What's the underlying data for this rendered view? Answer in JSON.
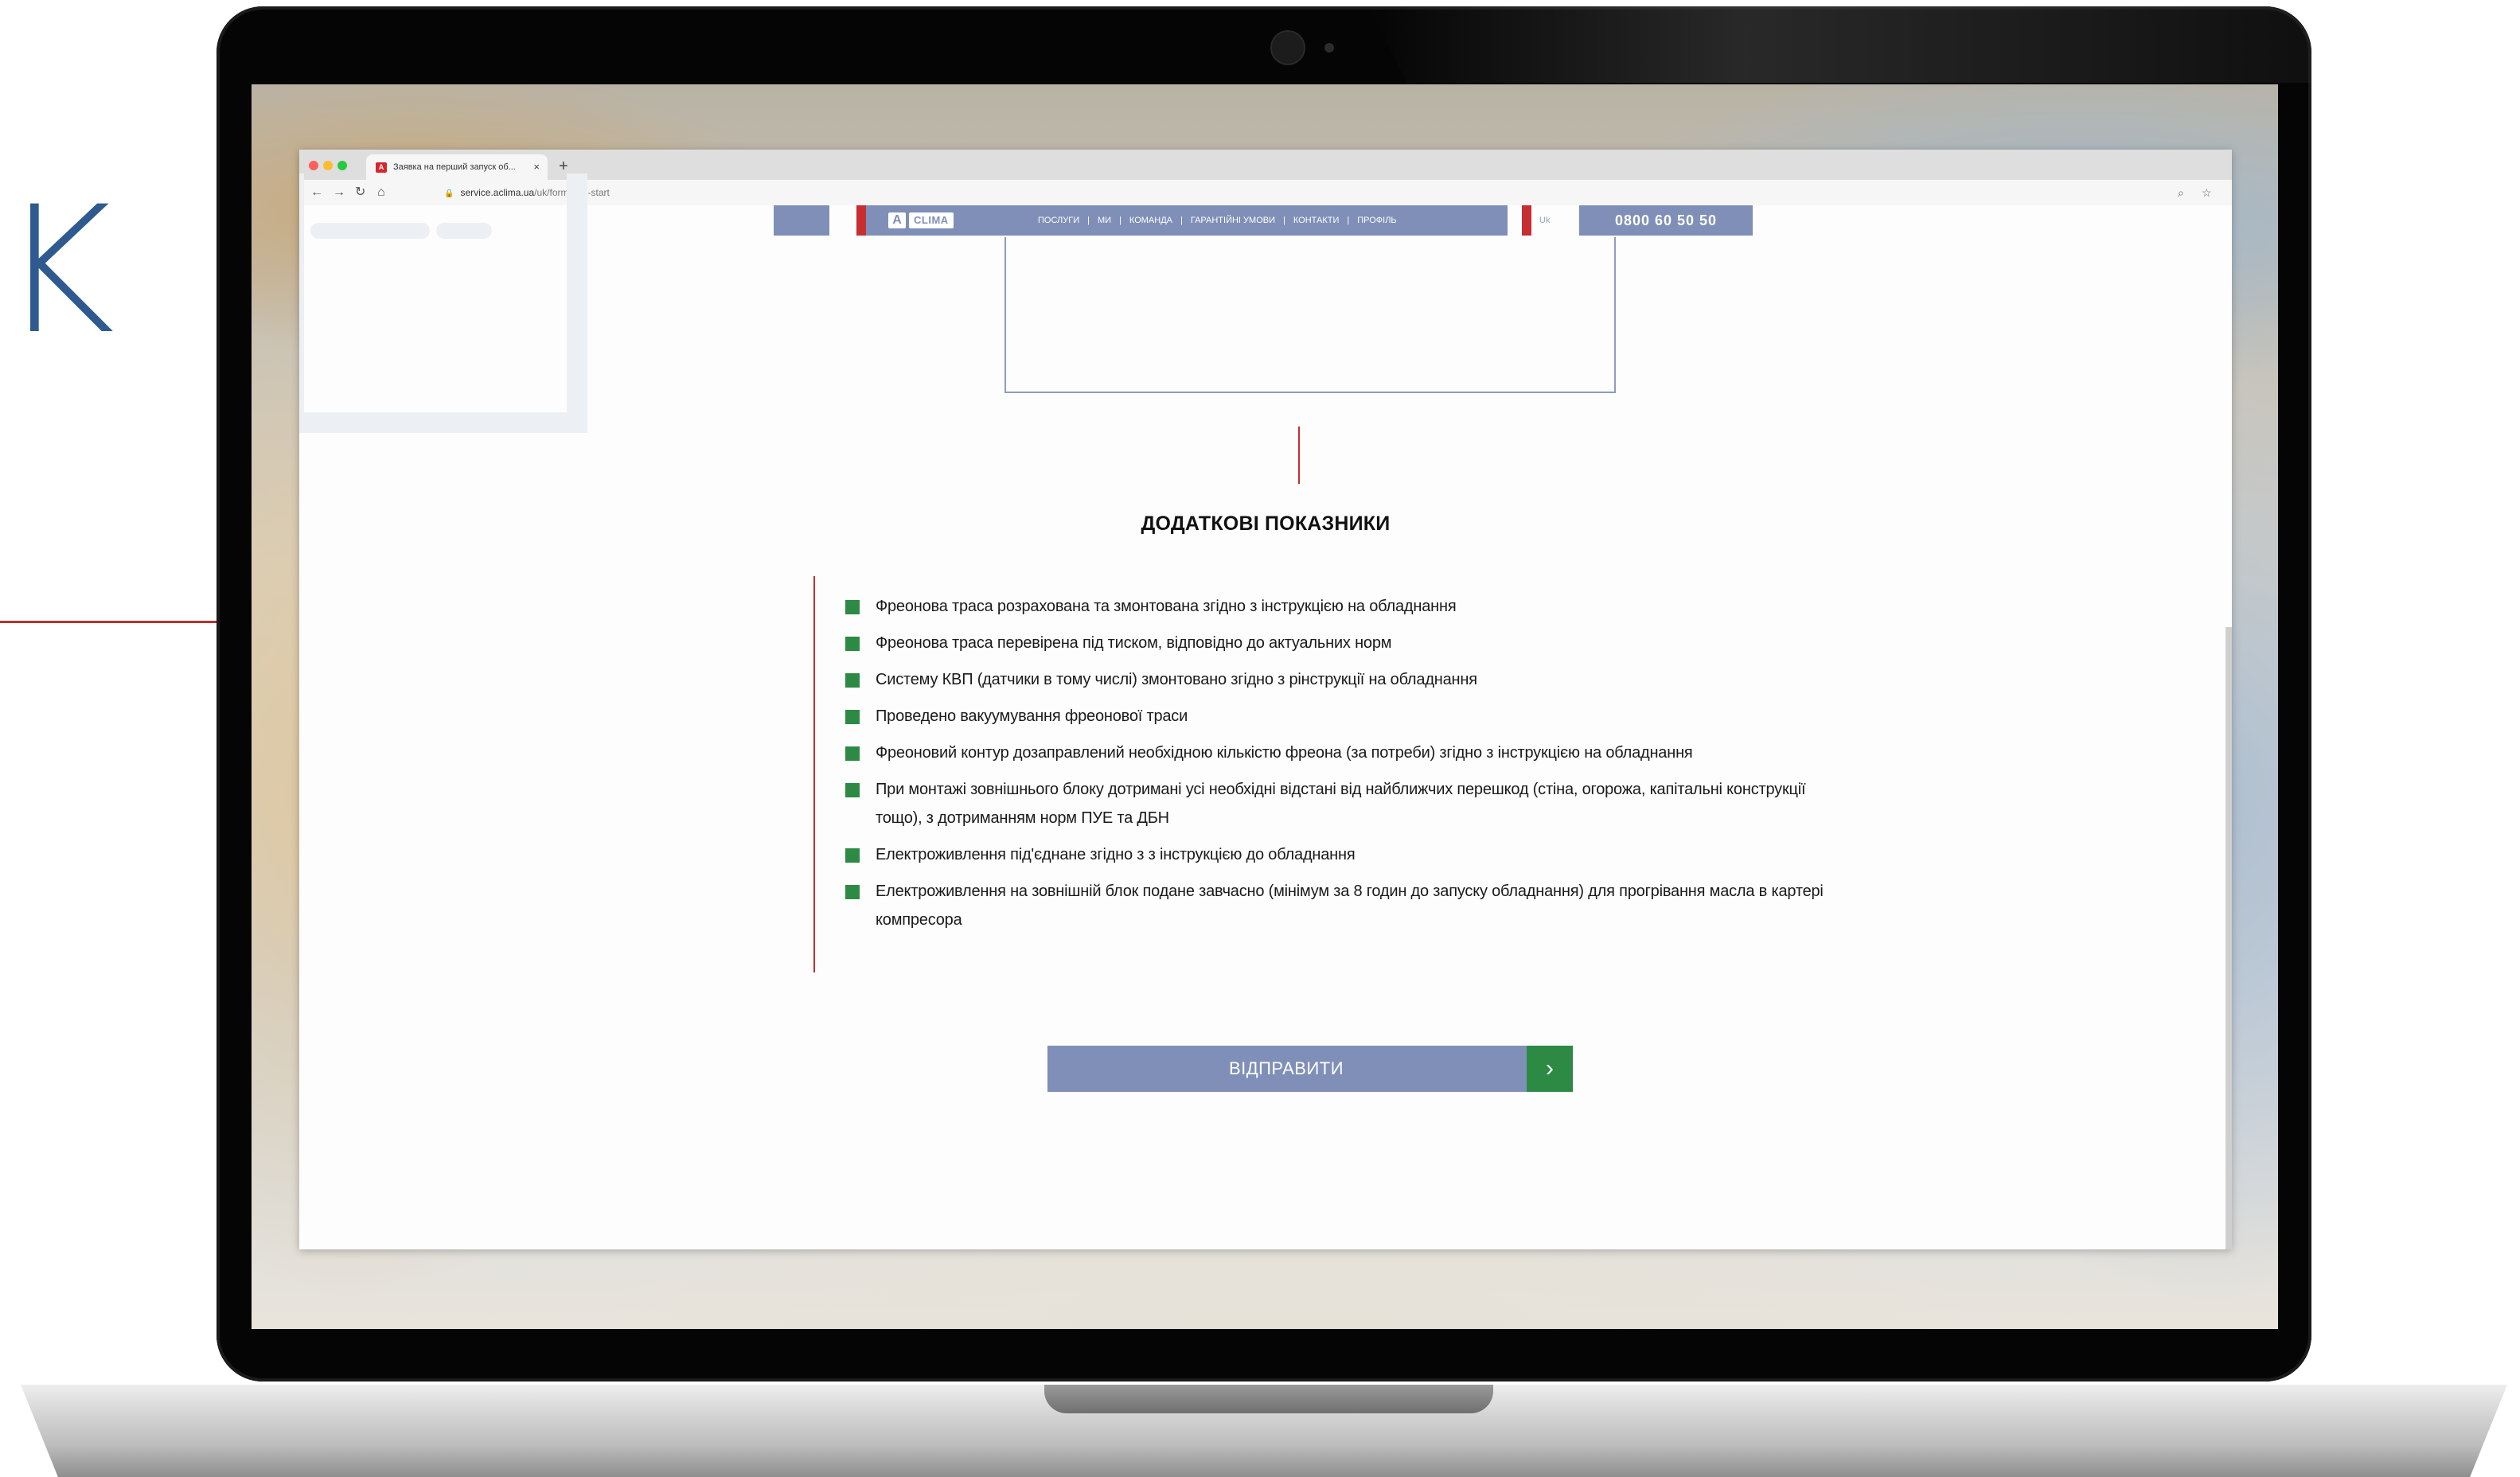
{
  "side": {
    "letter": "K"
  },
  "browser": {
    "tab_title": "Заявка на перший запуск об...",
    "tab_close": "×",
    "new_tab": "+",
    "url_domain": "service.aclima.ua",
    "url_path": "/uk/form-one-start"
  },
  "site": {
    "logo_mark": "A",
    "logo_text": "CLIMA",
    "nav": [
      "ПОСЛУГИ",
      "МИ",
      "КОМАНДА",
      "ГАРАНТІЙНІ УМОВИ",
      "КОНТАКТИ",
      "ПРОФІЛЬ"
    ],
    "nav_separator": "|",
    "lang": "Uk",
    "phone": "0800 60 50 50"
  },
  "section": {
    "title": "ДОДАТКОВІ ПОКАЗНИКИ",
    "items": [
      "Фреонова траса розрахована та змонтована згідно з інструкцією на обладнання",
      "Фреонова траса перевірена під тиском, відповідно до актуальних норм",
      "Систему КВП (датчики в тому числі) змонтовано згідно з рінструкції на обладнання",
      "Проведено вакуумування фреонової траси",
      "Фреоновий контур дозаправлений необхідною кількістю фреона (за потреби) згідно з інструкцією на обладнання",
      "При монтажі зовнішнього блоку дотримані усі необхідні відстані від найближчих перешкод (стіна, огорожа, капітальні конструкції тощо), з дотриманням норм ПУЕ та ДБН",
      "Електроживлення під'єднане згідно з з інструкцією до обладнання",
      "Електроживлення на зовнішній блок подане завчасно (мінімум за 8 годин до запуску обладнання) для прогрівання масла в картері компресора"
    ]
  },
  "submit": {
    "label": "ВІДПРАВИТИ",
    "arrow": "›"
  },
  "colors": {
    "accent_blue": "#7f8fb7",
    "accent_red": "#c72e31",
    "accent_green": "#2d8a45"
  }
}
